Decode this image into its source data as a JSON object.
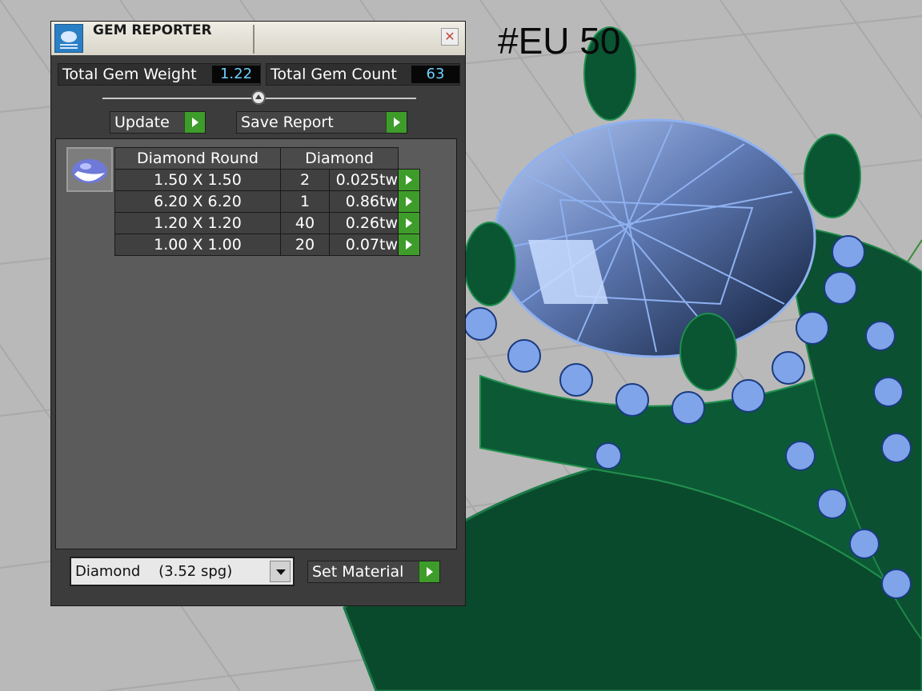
{
  "overlay_label": "#EU 50",
  "dialog": {
    "title": "GEM REPORTER",
    "close_icon": "close-x-icon",
    "total_gem_weight_label": "Total Gem Weight",
    "total_gem_weight_value": "1.22",
    "total_gem_count_label": "Total Gem Count",
    "total_gem_count_value": "63",
    "update_label": "Update",
    "save_report_label": "Save Report",
    "gem_icon": "gem-icon",
    "table": {
      "headers": [
        "Diamond Round",
        "Diamond"
      ],
      "rows": [
        {
          "size": "1.50 X 1.50",
          "count": "2",
          "weight": "0.025tw"
        },
        {
          "size": "6.20 X 6.20",
          "count": "1",
          "weight": "0.86tw"
        },
        {
          "size": "1.20 X 1.20",
          "count": "40",
          "weight": "0.26tw"
        },
        {
          "size": "1.00 X 1.00",
          "count": "20",
          "weight": "0.07tw"
        }
      ]
    },
    "material_select_value": "Diamond    (3.52 spg)",
    "set_material_label": "Set Material"
  },
  "colors": {
    "accent_green": "#3e9c2a",
    "value_cyan": "#6ad0ff",
    "panel_bg": "#3c3c3c"
  }
}
